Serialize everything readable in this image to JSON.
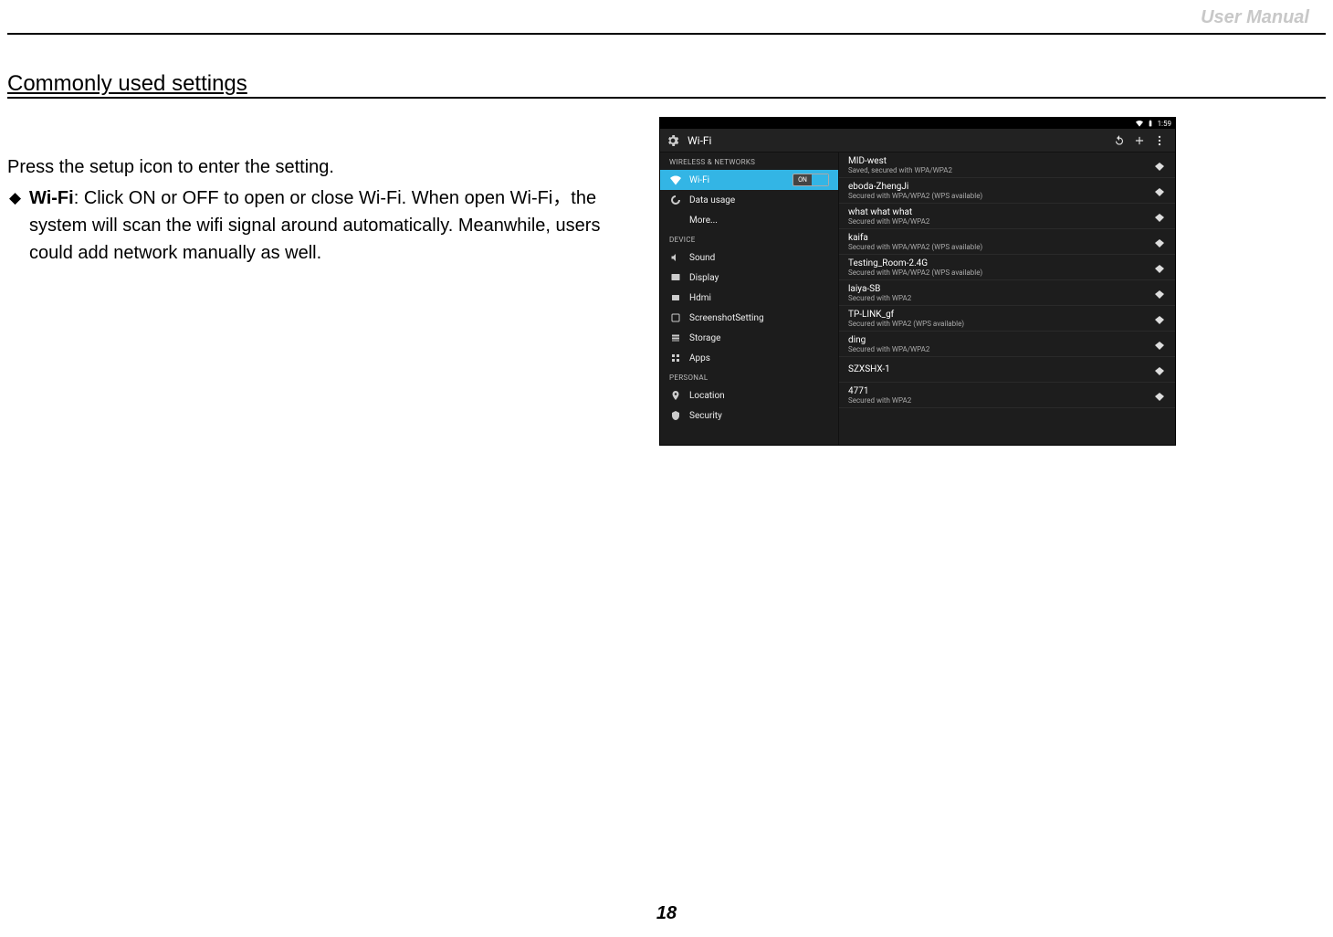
{
  "header": {
    "right": "User Manual"
  },
  "section_title": "Commonly used settings",
  "intro": "Press the setup icon to enter the setting.",
  "bullet": {
    "label": "Wi-Fi",
    "text": ": Click ON or OFF to open or close Wi-Fi. When open Wi-Fi，the system will scan the wifi signal around automatically. Meanwhile, users could add network manually as well."
  },
  "page_number": "18",
  "screenshot": {
    "status_time": "1:59",
    "title": "Wi-Fi",
    "toggle_label": "ON",
    "sidebar": {
      "section_wireless": "WIRELESS & NETWORKS",
      "section_device": "DEVICE",
      "section_personal": "PERSONAL",
      "items": [
        {
          "label": "Wi-Fi",
          "icon": "wifi",
          "selected": true,
          "toggle": true
        },
        {
          "label": "Data usage",
          "icon": "data"
        },
        {
          "label": "More...",
          "icon": ""
        },
        {
          "label": "Sound",
          "icon": "sound"
        },
        {
          "label": "Display",
          "icon": "display"
        },
        {
          "label": "Hdmi",
          "icon": "hdmi"
        },
        {
          "label": "ScreenshotSetting",
          "icon": "screenshot"
        },
        {
          "label": "Storage",
          "icon": "storage"
        },
        {
          "label": "Apps",
          "icon": "apps"
        },
        {
          "label": "Location",
          "icon": "location"
        },
        {
          "label": "Security",
          "icon": "security"
        }
      ]
    },
    "networks": [
      {
        "ssid": "MID-west",
        "sub": "Saved, secured with WPA/WPA2"
      },
      {
        "ssid": "eboda-ZhengJi",
        "sub": "Secured with WPA/WPA2 (WPS available)"
      },
      {
        "ssid": "what what what",
        "sub": "Secured with WPA/WPA2"
      },
      {
        "ssid": "kaifa",
        "sub": "Secured with WPA/WPA2 (WPS available)"
      },
      {
        "ssid": "Testing_Room-2.4G",
        "sub": "Secured with WPA/WPA2 (WPS available)"
      },
      {
        "ssid": "laiya-SB",
        "sub": "Secured with WPA2"
      },
      {
        "ssid": "TP-LINK_gf",
        "sub": "Secured with WPA2 (WPS available)"
      },
      {
        "ssid": "ding",
        "sub": "Secured with WPA/WPA2"
      },
      {
        "ssid": "SZXSHX-1",
        "sub": ""
      },
      {
        "ssid": "4771",
        "sub": "Secured with WPA2"
      }
    ]
  }
}
